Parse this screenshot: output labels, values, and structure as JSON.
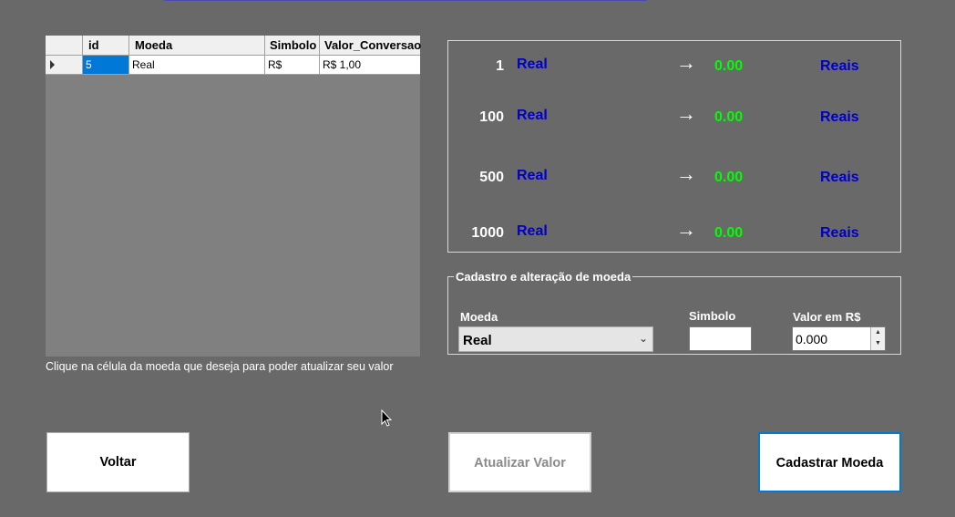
{
  "grid": {
    "columns": [
      "id",
      "Moeda",
      "Simbolo",
      "Valor_Conversao"
    ],
    "rows": [
      {
        "id": "5",
        "moeda": "Real",
        "simbolo": "R$",
        "valor": "R$ 1,00"
      }
    ]
  },
  "hint": "Clique na célula da moeda que deseja para poder atualizar seu valor",
  "conversion": {
    "rows": [
      {
        "amount": "1",
        "currency": "Real",
        "arrow": "→",
        "result": "0.00",
        "target": "Reais"
      },
      {
        "amount": "100",
        "currency": "Real",
        "arrow": "→",
        "result": "0.00",
        "target": "Reais"
      },
      {
        "amount": "500",
        "currency": "Real",
        "arrow": "→",
        "result": "0.00",
        "target": "Reais"
      },
      {
        "amount": "1000",
        "currency": "Real",
        "arrow": "→",
        "result": "0.00",
        "target": "Reais"
      }
    ]
  },
  "form": {
    "group_title": "Cadastro e alteração de moeda",
    "moeda_label": "Moeda",
    "moeda_value": "Real",
    "simbolo_label": "Simbolo",
    "simbolo_value": "",
    "valor_label": "Valor em R$",
    "valor_value": "0.000"
  },
  "buttons": {
    "voltar": "Voltar",
    "atualizar": "Atualizar Valor",
    "cadastrar": "Cadastrar Moeda"
  },
  "colors": {
    "background": "#696969",
    "currency_text": "#0000c8",
    "result_text": "#00ff00",
    "selection": "#0078d7"
  }
}
